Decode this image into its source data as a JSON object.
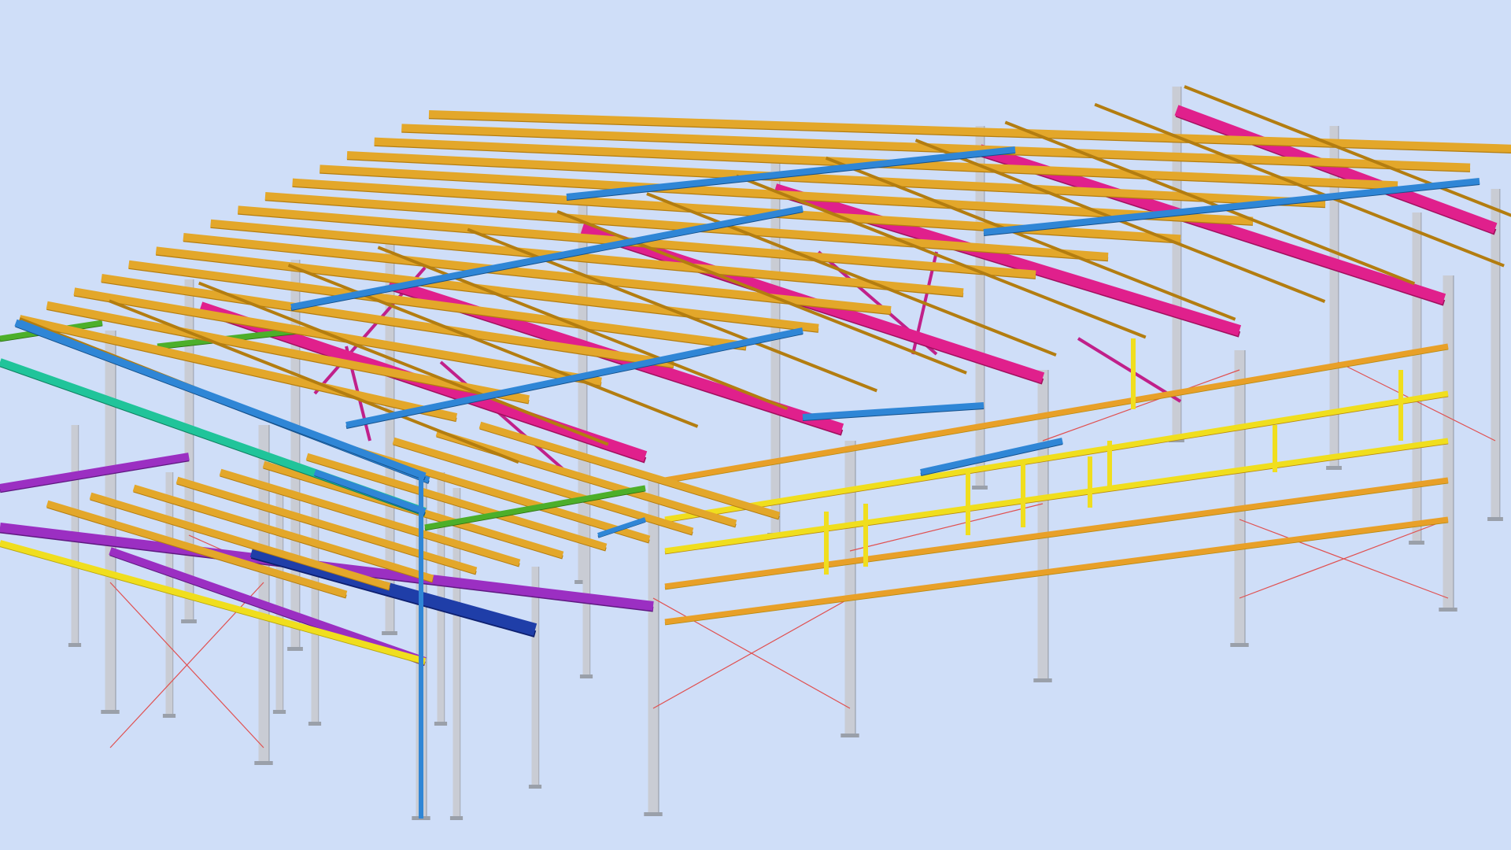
{
  "scene": {
    "subject": "3d-steel-structure-model",
    "background_color": "#cfdef8",
    "member_colors": {
      "column": "#c9ccd4",
      "column_dark": "#8f95a0",
      "roof_purlin": "#e3a72a",
      "roof_purlin_dark": "#b37d10",
      "roof_beam": "#2f86d6",
      "rafter": "#e0208c",
      "wall_girt": "#f0de1e",
      "wall_girt_secondary": "#e8a028",
      "mezzanine_edge": "#9b2fc2",
      "mezzanine_deck": "#e3a72a",
      "mezzanine_beam_dark": "#1f3ea8",
      "handrail": "#20c49a",
      "green_member": "#4caf2a",
      "bracing_rod": "#e05050",
      "bracing_rod_magenta": "#c0208a"
    }
  }
}
